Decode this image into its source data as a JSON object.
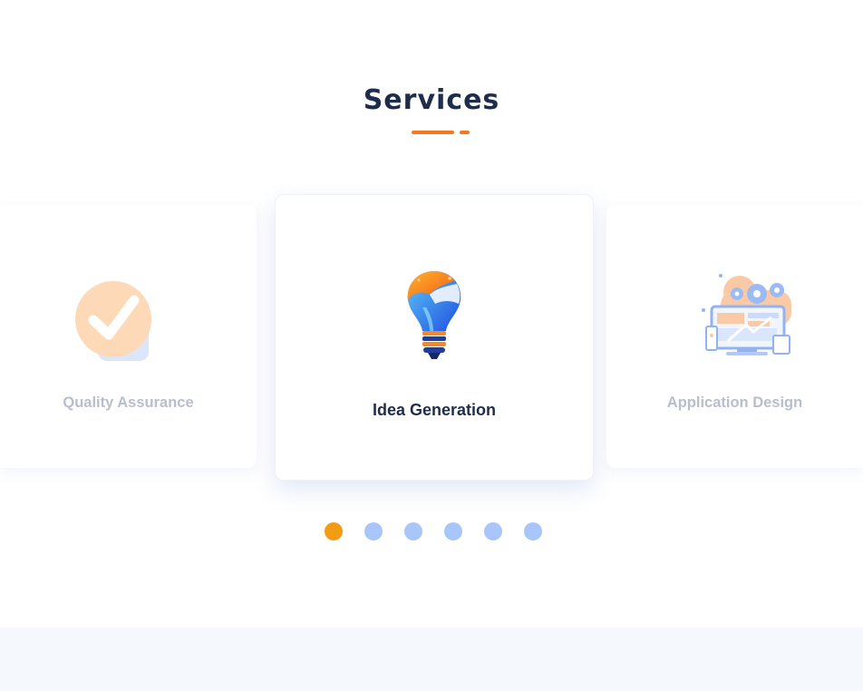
{
  "section": {
    "title": "Services",
    "accent_color": "#f37920"
  },
  "carousel": {
    "cards": [
      {
        "label": "Quality Assurance",
        "icon": "checkmark-badge-icon",
        "state": "inactive"
      },
      {
        "label": "Idea Generation",
        "icon": "lightbulb-icon",
        "state": "active"
      },
      {
        "label": "Application Design",
        "icon": "app-design-gears-icon",
        "state": "inactive"
      }
    ],
    "pagination": {
      "count": 6,
      "active_index": 0,
      "active_color": "#f29b15",
      "inactive_color": "#a9c6fa"
    }
  }
}
